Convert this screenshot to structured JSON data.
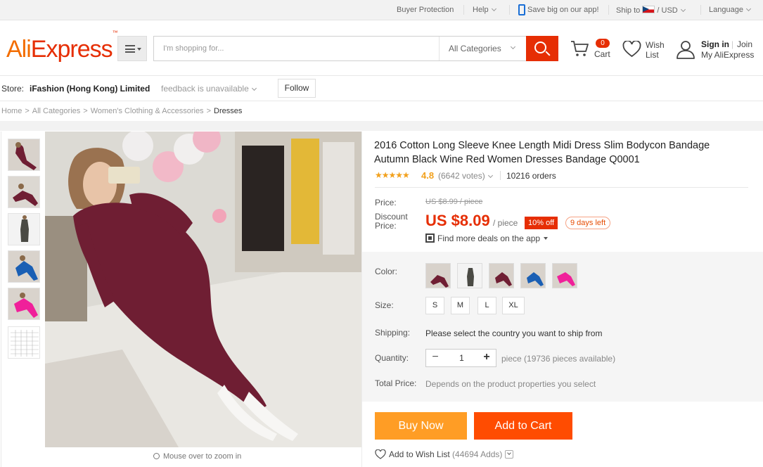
{
  "topbar": {
    "buyer_protection": "Buyer Protection",
    "help": "Help",
    "app_promo": "Save big on our app!",
    "ship_to": "Ship to",
    "currency_sep": "/",
    "currency": "USD",
    "language": "Language"
  },
  "header": {
    "logo_part1": "Ali",
    "logo_part2": "Express",
    "logo_tm": "™",
    "search_placeholder": "I'm shopping for...",
    "category": "All Categories",
    "cart_count": "0",
    "cart_label": "Cart",
    "wish_line1": "Wish",
    "wish_line2": "List",
    "sign_in": "Sign in",
    "join_sep": "|",
    "join": "Join",
    "my_account": "My AliExpress"
  },
  "store": {
    "label": "Store:",
    "name": "iFashion (Hong Kong) Limited",
    "feedback": "feedback is unavailable",
    "follow": "Follow"
  },
  "breadcrumb": {
    "items": [
      "Home",
      "All Categories",
      "Women's Clothing & Accessories"
    ],
    "current": "Dresses",
    "separator": ">"
  },
  "gallery": {
    "zoom_hint": "Mouse over to zoom in"
  },
  "product": {
    "title": "2016 Cotton Long Sleeve Knee Length Midi Dress Slim Bodycon Bandage Autumn Black Wine Red Women Dresses Bandage Q0001",
    "stars": "★★★★★",
    "rating": "4.8",
    "votes": "(6642 votes)",
    "orders": "10216 orders",
    "price_label": "Price:",
    "old_price": "US $8.99 / piece",
    "discount_label_line1": "Discount",
    "discount_label_line2": "Price:",
    "price": "US $8.09",
    "per_piece": "/ piece",
    "off_badge": "10% off",
    "days_left": "9 days left",
    "app_deals": "Find more deals on the app",
    "color_label": "Color:",
    "size_label": "Size:",
    "sizes": [
      "S",
      "M",
      "L",
      "XL"
    ],
    "shipping_label": "Shipping:",
    "shipping_text": "Please select the country you want to ship from",
    "quantity_label": "Quantity:",
    "quantity_minus": "−",
    "quantity_value": "1",
    "quantity_plus": "+",
    "availability": "piece (19736 pieces available)",
    "total_label": "Total Price:",
    "total_text": "Depends on the product properties you select",
    "buy_now": "Buy Now",
    "add_to_cart": "Add to Cart",
    "wishlist": "Add to Wish List",
    "wishlist_adds": "(44694 Adds)"
  },
  "colors": {
    "brand_red": "#e62e04",
    "brand_orange": "#f36d00",
    "buy_now_bg": "#ff9d25",
    "add_to_cart_bg": "#ff4c01",
    "rating_star": "#f2a11d",
    "dress_wine": "#6f1e33"
  }
}
